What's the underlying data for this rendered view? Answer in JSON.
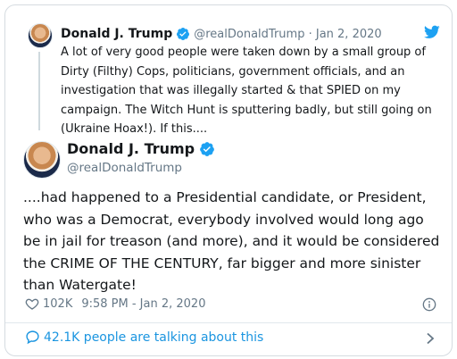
{
  "parent_tweet": {
    "name": "Donald J. Trump",
    "handle": "@realDonaldTrump",
    "date_sep": " · ",
    "date": "Jan 2, 2020",
    "text": "A lot of very good people were taken down by a small group of Dirty (Filthy) Cops, politicians, government officials, and an investigation that was illegally started & that SPIED on my campaign. The Witch Hunt is sputtering badly, but still going on (Ukraine Hoax!). If this...."
  },
  "main_tweet": {
    "name": "Donald J. Trump",
    "handle": "@realDonaldTrump",
    "text": "....had happened to a Presidential candidate, or President, who was a Democrat, everybody involved would long ago be in jail for treason (and more), and it would be considered the CRIME OF THE CENTURY, far bigger and more sinister than Watergate!",
    "likes": "102K",
    "timestamp": "9:58 PM - Jan 2, 2020"
  },
  "footer": {
    "talking_label": "42.1K people are talking about this"
  },
  "colors": {
    "text": "#14171a",
    "muted": "#657786",
    "accent": "#1b95e0",
    "verified": "#1da1f2",
    "border": "#d5dbe0"
  },
  "icons": [
    "verified-badge-icon",
    "twitter-bird-icon",
    "heart-icon",
    "info-icon",
    "comment-bubble-icon",
    "chevron-right-icon"
  ]
}
